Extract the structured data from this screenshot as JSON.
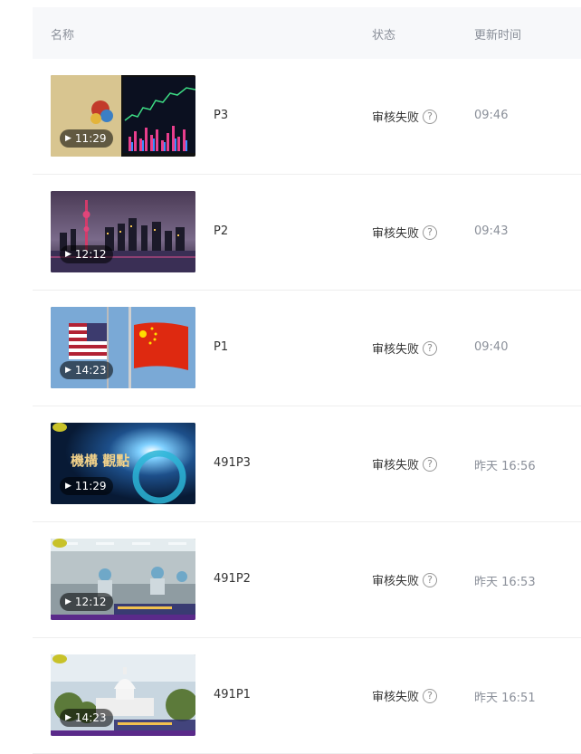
{
  "header": {
    "name": "名称",
    "status": "状态",
    "updated": "更新时间"
  },
  "rows": [
    {
      "thumbnail": "stock-chart-tablet",
      "duration": "11:29",
      "name": "P3",
      "status": "审核失败",
      "time": "09:46"
    },
    {
      "thumbnail": "city-skyline-night",
      "duration": "12:12",
      "name": "P2",
      "status": "审核失败",
      "time": "09:43"
    },
    {
      "thumbnail": "us-china-flags",
      "duration": "14:23",
      "name": "P1",
      "status": "审核失败",
      "time": "09:40"
    },
    {
      "thumbnail": "news-intro-graphic",
      "duration": "11:29",
      "name": "491P3",
      "status": "审核失败",
      "time": "昨天 16:56",
      "overlay_text": "機構 觀點"
    },
    {
      "thumbnail": "factory-workers",
      "duration": "12:12",
      "name": "491P2",
      "status": "审核失败",
      "time": "昨天 16:53"
    },
    {
      "thumbnail": "capitol-building",
      "duration": "14:23",
      "name": "491P1",
      "status": "审核失败",
      "time": "昨天 16:51"
    }
  ],
  "icons": {
    "help": "question-circle-icon",
    "play": "play-icon"
  }
}
